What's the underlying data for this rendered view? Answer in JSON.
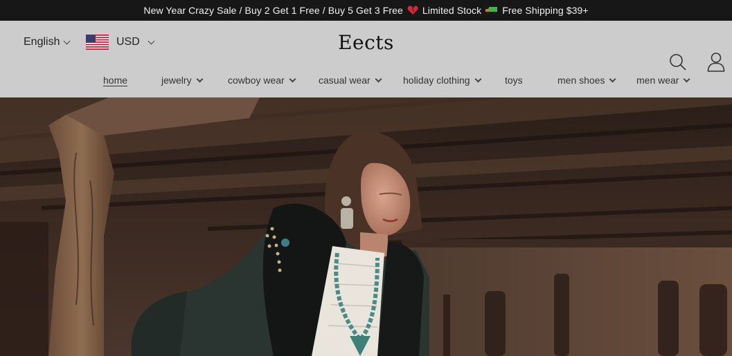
{
  "announcement": {
    "part1": "New Year Crazy Sale / Buy 2 Get 1 Free / Buy 5 Get 3 Free",
    "part2": "Limited Stock",
    "part3": "Free Shipping $39+",
    "icons": [
      "broken-heart-icon",
      "truck-icon"
    ]
  },
  "header": {
    "language": "English",
    "currency": "USD",
    "logo": "Eects"
  },
  "nav": {
    "items": [
      {
        "label": "home",
        "dropdown": false,
        "active": true
      },
      {
        "label": "jewelry",
        "dropdown": true
      },
      {
        "label": "cowboy wear",
        "dropdown": true
      },
      {
        "label": "casual wear",
        "dropdown": true
      },
      {
        "label": "holiday clothing",
        "dropdown": true
      },
      {
        "label": "toys",
        "dropdown": false
      },
      {
        "label": "men shoes",
        "dropdown": true
      },
      {
        "label": "men wear",
        "dropdown": true
      }
    ]
  },
  "colors": {
    "announcement_bg": "#171717",
    "header_bg": "#cccccc",
    "text": "#333333"
  }
}
